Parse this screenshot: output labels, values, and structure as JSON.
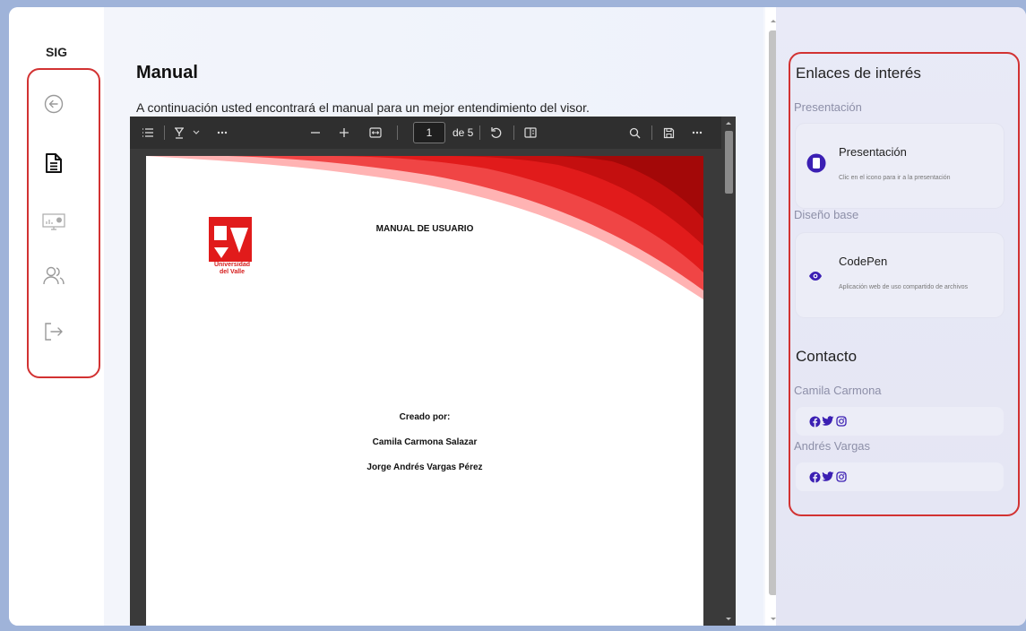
{
  "sidebar": {
    "brand": "SIG",
    "items": [
      {
        "icon": "back-arrow-icon",
        "active": false
      },
      {
        "icon": "document-icon",
        "active": true
      },
      {
        "icon": "monitor-chart-icon",
        "active": false
      },
      {
        "icon": "users-icon",
        "active": false
      },
      {
        "icon": "logout-icon",
        "active": false
      }
    ]
  },
  "main": {
    "title": "Manual",
    "description": "A continuación usted encontrará el manual para un mejor entendimiento del visor."
  },
  "pdf": {
    "current_page": "1",
    "total_pages": "de 5",
    "doc_title": "MANUAL DE USUARIO",
    "logo_text_1": "Universidad",
    "logo_text_2": "del Valle",
    "credits_label": "Creado por:",
    "author_1": "Camila Carmona Salazar",
    "author_2": "Jorge Andrés Vargas Pérez"
  },
  "right_panel": {
    "links_heading": "Enlaces de interés",
    "section_1_label": "Presentación",
    "card_1": {
      "title": "Presentación",
      "description": "Clic en el icono para ir a la presentación"
    },
    "section_2_label": "Diseño base",
    "card_2": {
      "title": "CodePen",
      "description": "Aplicación web de uso compartido de archivos"
    },
    "contact_heading": "Contacto",
    "contact_1_name": "Camila Carmona",
    "contact_2_name": "Andrés Vargas"
  },
  "colors": {
    "accent_purple": "#3b1fb3",
    "highlight_red": "#d23232",
    "brand_red": "#e11b1b"
  }
}
